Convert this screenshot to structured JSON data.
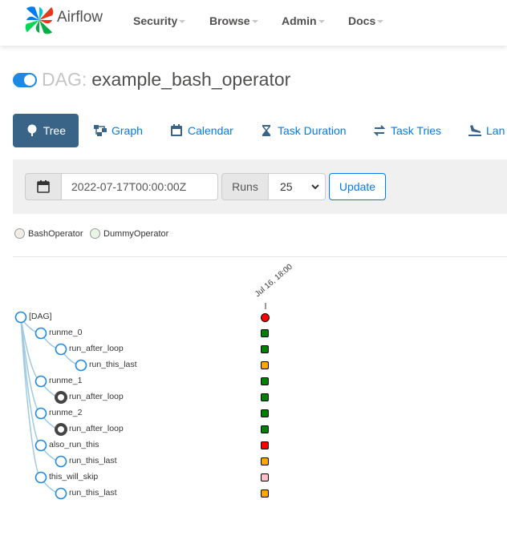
{
  "nav": {
    "brand": "Airflow",
    "items": [
      "Security",
      "Browse",
      "Admin",
      "Docs"
    ]
  },
  "dag": {
    "prefix": "DAG:",
    "name": "example_bash_operator",
    "paused": false
  },
  "tabs": [
    {
      "label": "Tree",
      "icon": "tree-icon",
      "active": true
    },
    {
      "label": "Graph",
      "icon": "graph-icon",
      "active": false
    },
    {
      "label": "Calendar",
      "icon": "calendar-icon",
      "active": false
    },
    {
      "label": "Task Duration",
      "icon": "hourglass-icon",
      "active": false
    },
    {
      "label": "Task Tries",
      "icon": "retry-icon",
      "active": false
    },
    {
      "label": "Lan",
      "icon": "landing-icon",
      "active": false
    }
  ],
  "filter": {
    "date_value": "2022-07-17T00:00:00Z",
    "runs_label": "Runs",
    "runs_value": "25",
    "update_label": "Update"
  },
  "legend": [
    {
      "label": "BashOperator",
      "color": "#f0ede4"
    },
    {
      "label": "DummyOperator",
      "color": "#e8f7e4"
    }
  ],
  "tree": {
    "run_date": "Jul 16, 18:00",
    "nodes": [
      {
        "label": "[DAG]",
        "depth": 0,
        "status": "failed",
        "color": "#ff0000",
        "collapsed": false
      },
      {
        "label": "runme_0",
        "depth": 1,
        "status": "success",
        "color": "#008000",
        "collapsed": false
      },
      {
        "label": "run_after_loop",
        "depth": 2,
        "status": "success",
        "color": "#008000",
        "collapsed": false
      },
      {
        "label": "run_this_last",
        "depth": 3,
        "status": "upstream_failed",
        "color": "#ffa500",
        "collapsed": false
      },
      {
        "label": "runme_1",
        "depth": 1,
        "status": "success",
        "color": "#008000",
        "collapsed": false
      },
      {
        "label": "run_after_loop",
        "depth": 2,
        "status": "success",
        "color": "#008000",
        "collapsed": true
      },
      {
        "label": "runme_2",
        "depth": 1,
        "status": "success",
        "color": "#008000",
        "collapsed": false
      },
      {
        "label": "run_after_loop",
        "depth": 2,
        "status": "success",
        "color": "#008000",
        "collapsed": true
      },
      {
        "label": "also_run_this",
        "depth": 1,
        "status": "failed",
        "color": "#ff0000",
        "collapsed": false
      },
      {
        "label": "run_this_last",
        "depth": 2,
        "status": "upstream_failed",
        "color": "#ffa500",
        "collapsed": false
      },
      {
        "label": "this_will_skip",
        "depth": 1,
        "status": "skipped",
        "color": "#ffc0cb",
        "collapsed": false
      },
      {
        "label": "run_this_last",
        "depth": 2,
        "status": "upstream_failed",
        "color": "#ffa500",
        "collapsed": false
      }
    ]
  }
}
